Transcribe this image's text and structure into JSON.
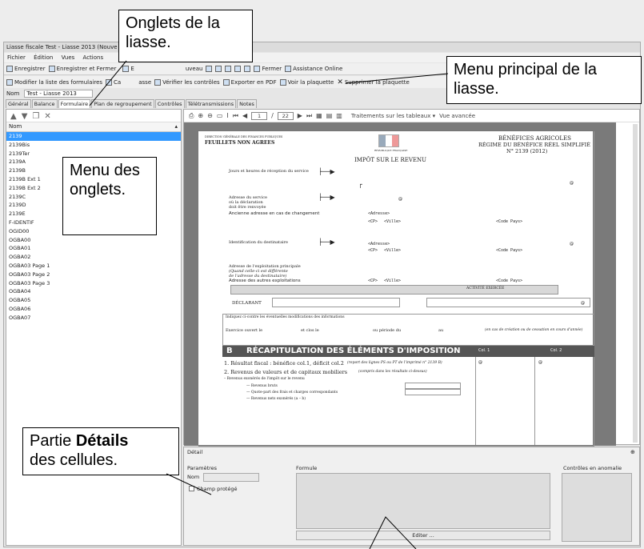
{
  "window": {
    "title": "Liasse fiscale Test - Liasse 2013 (Nouve"
  },
  "menu": [
    "Fichier",
    "Édition",
    "Vues",
    "Actions"
  ],
  "toolbar1": {
    "enregistrer": "Enregistrer",
    "enregistrer_fermer": "Enregistrer et Fermer",
    "nouveau": "uveau",
    "fermer": "Fermer",
    "assistance": "Assistance Online",
    "e_label": "E"
  },
  "toolbar2": {
    "modifier": "Modifier la liste des formulaires",
    "ca": "Ca",
    "asse": "asse",
    "verifier": "Vérifier les contrôles",
    "exporter": "Exporter en PDF",
    "voir": "Voir la plaquette",
    "supprimer": "Supprimer la plaquette"
  },
  "name_row": {
    "label": "Nom",
    "value": "Test - Liasse 2013"
  },
  "tabs": [
    "Général",
    "Balance",
    "Formulaire",
    "Plan de regroupement",
    "Contrôles",
    "Télétransmissions",
    "Notes"
  ],
  "form_list": {
    "header": "Nom",
    "items": [
      "2139",
      "2139Bis",
      "2139Ter",
      "2139A",
      "2139B",
      "2139B Ext 1",
      "2139B Ext 2",
      "2139C",
      "2139D",
      "2139E",
      "F-IDENTIF",
      "OGID00",
      "OGBA00",
      "OGBA01",
      "OGBA02",
      "OGBA03 Page 1",
      "OGBA03 Page 2",
      "OGBA03 Page 3",
      "OGBA04",
      "OGBA05",
      "OGBA06",
      "OGBA07"
    ]
  },
  "doc_toolbar": {
    "page": "1",
    "total": "22",
    "traitements": "Traitements sur les tableaux",
    "vue": "Vue avancée"
  },
  "doc": {
    "header_left1": "DIRECTION GÉNÉRALE DES FINANCES PUBLIQUES",
    "header_left2": "FEUILLETS NON AGREES",
    "republique": "RÉPUBLIQUE FRANÇAISE",
    "header_right1": "BÉNÉFICES AGRICOLES",
    "header_right2": "RÉGIME DU BÉNÉFICE RÉEL SIMPLIFIÉ",
    "header_right3": "N° 2139 (2012)",
    "impot": "IMPÔT SUR LE REVENU",
    "jours": "Jours et heures de réception du service",
    "adresse_service": "Adresse du service",
    "adresse_decl": "où la déclaration",
    "adresse_renv": "doit être renvoyée",
    "ancienne": "Ancienne adresse en cas de changement",
    "tag_adresse": "<Adresse>",
    "tag_cp": "<CP>",
    "tag_ville": "<Ville>",
    "tag_codepays": "<Code Pays>",
    "identification": "Identification du destinataire",
    "expl1": "Adresse de l'exploitation principale",
    "expl2": "(Quand celle-ci est différente",
    "expl3": "de l'adresse du destinataire)",
    "autres": "Adresse des autres exploitations",
    "activite": "ACTIVITÉ EXERCÉE",
    "declarant": "DÉCLARANT",
    "indiquez": "Indiquez ci-contre les éventuelles modifications des informations",
    "exercice": "Exercice ouvert le",
    "clos": "et clos le",
    "periode": "ou période du",
    "au": "au",
    "creation": "(en cas de création ou de cessation en cours d'année)",
    "section_b": "B",
    "recap": "RÉCAPITULATION DES ÉLÉMENTS D'IMPOSITION",
    "col1": "Col. 1",
    "col2": "Col. 2",
    "resultat": "1. Résultat fiscal : bénéfice col.1, déficit col.2",
    "resultat_note": "(report des lignes PS ou PT de l'imprimé n° 2139 B)",
    "revenus": "2. Revenus de valeurs et de capitaux mobiliers",
    "revenus_note": "(compris dans les résultats ci-dessus)",
    "exoneres": "– Revenus exonérés de l'impôt sur le revenu",
    "bruts": "— Revenus bruts",
    "quote": "— Quote-part des frais et charges correspondants",
    "nets": "— Revenus nets exonérés (a – b)",
    "at": "@"
  },
  "detail": {
    "title": "Détail",
    "parametres": "Paramètres",
    "nom": "Nom",
    "champ": "Champ protégé",
    "formule": "Formule",
    "editer": "Editer ...",
    "controles": "Contrôles en anomalie"
  },
  "callouts": {
    "onglets": "Onglets de la liasse.",
    "menu_principal": "Menu principal de la liasse.",
    "menu_onglets": "Menu des onglets.",
    "details": "des cellules."
  }
}
